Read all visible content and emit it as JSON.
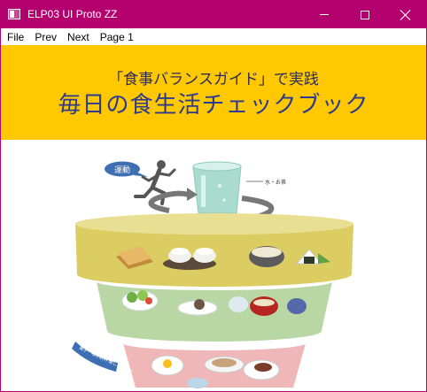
{
  "window": {
    "title": "ELP03 UI Proto ZZ"
  },
  "menu": {
    "items": [
      "File",
      "Prev",
      "Next",
      "Page 1"
    ]
  },
  "banner": {
    "subtitle": "「食事バランスガイド」で実践",
    "title": "毎日の食生活チェックブック"
  },
  "illustration": {
    "run_label": "運動",
    "water_label": "水・お茶",
    "ribbon_label": "菓子・嗜好飲料 楽しく適度に"
  },
  "colors": {
    "titlebar": "#b4006e",
    "banner": "#ffc800",
    "title_text": "#2e3a8c"
  }
}
